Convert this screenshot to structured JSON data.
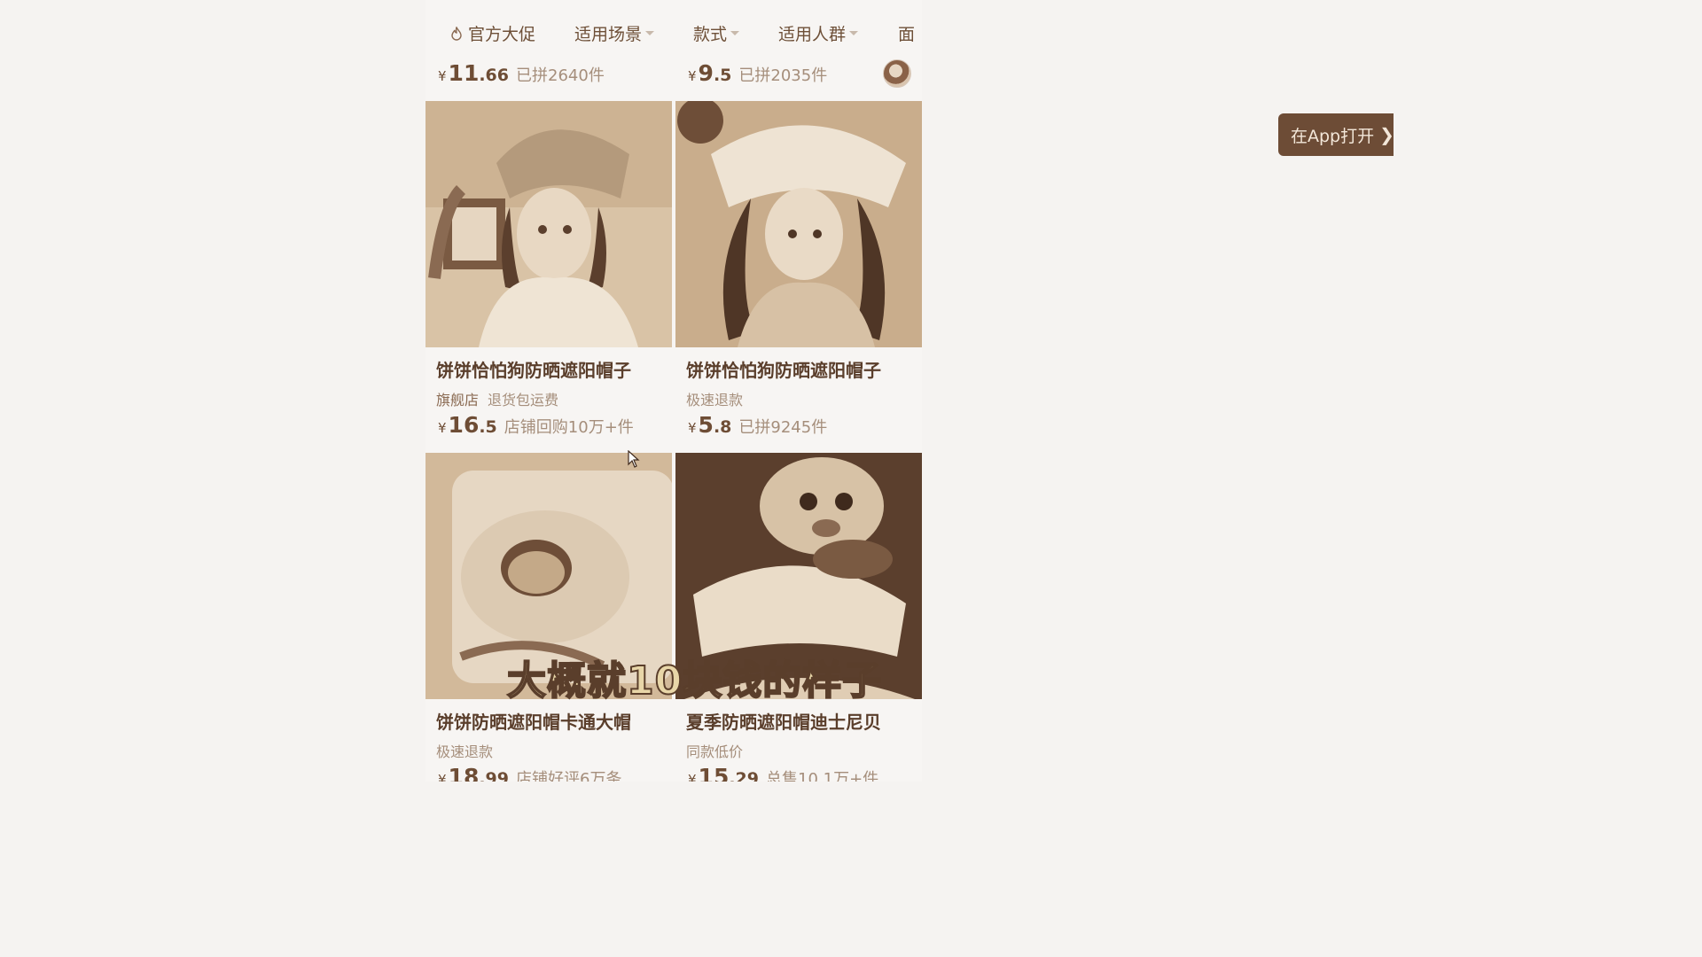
{
  "filter_bar": {
    "items": [
      {
        "label": "官方大促",
        "icon": "flame-icon",
        "dropdown": false
      },
      {
        "label": "适用场景",
        "dropdown": true
      },
      {
        "label": "款式",
        "dropdown": true
      },
      {
        "label": "适用人群",
        "dropdown": true
      },
      {
        "label": "面",
        "dropdown": false
      }
    ]
  },
  "top_row": [
    {
      "price_int": "11",
      "price_dec": ".66",
      "sold": "已拼2640件"
    },
    {
      "price_int": "9",
      "price_dec": ".5",
      "sold": "已拼2035件"
    }
  ],
  "currency": "¥",
  "products": [
    {
      "title": "饼饼恰怕狗防晒遮阳帽子",
      "tag_strong": "旗舰店",
      "tag": "退货包运费",
      "price_int": "16",
      "price_dec": ".5",
      "sold": "店铺回购10万+件"
    },
    {
      "title": "饼饼恰怕狗防晒遮阳帽子",
      "tag_strong": "",
      "tag": "极速退款",
      "price_int": "5",
      "price_dec": ".8",
      "sold": "已拼9245件"
    },
    {
      "title": "饼饼防晒遮阳帽卡通大帽",
      "tag_strong": "",
      "tag": "极速退款",
      "price_int": "18",
      "price_dec": ".99",
      "sold": "店铺好评6万条"
    },
    {
      "title": "夏季防晒遮阳帽迪士尼贝",
      "tag_strong": "",
      "tag": "同款低价",
      "price_int": "15",
      "price_dec": ".29",
      "sold": "总售10.1万+件"
    }
  ],
  "open_app_button": {
    "label": "在App打开"
  },
  "video_subtitle": "大概就10块钱的样子",
  "colors": {
    "accent": "#6d4c36",
    "background": "#f5f3f1",
    "text": "#5a3e2b",
    "muted": "#a58e7b"
  }
}
